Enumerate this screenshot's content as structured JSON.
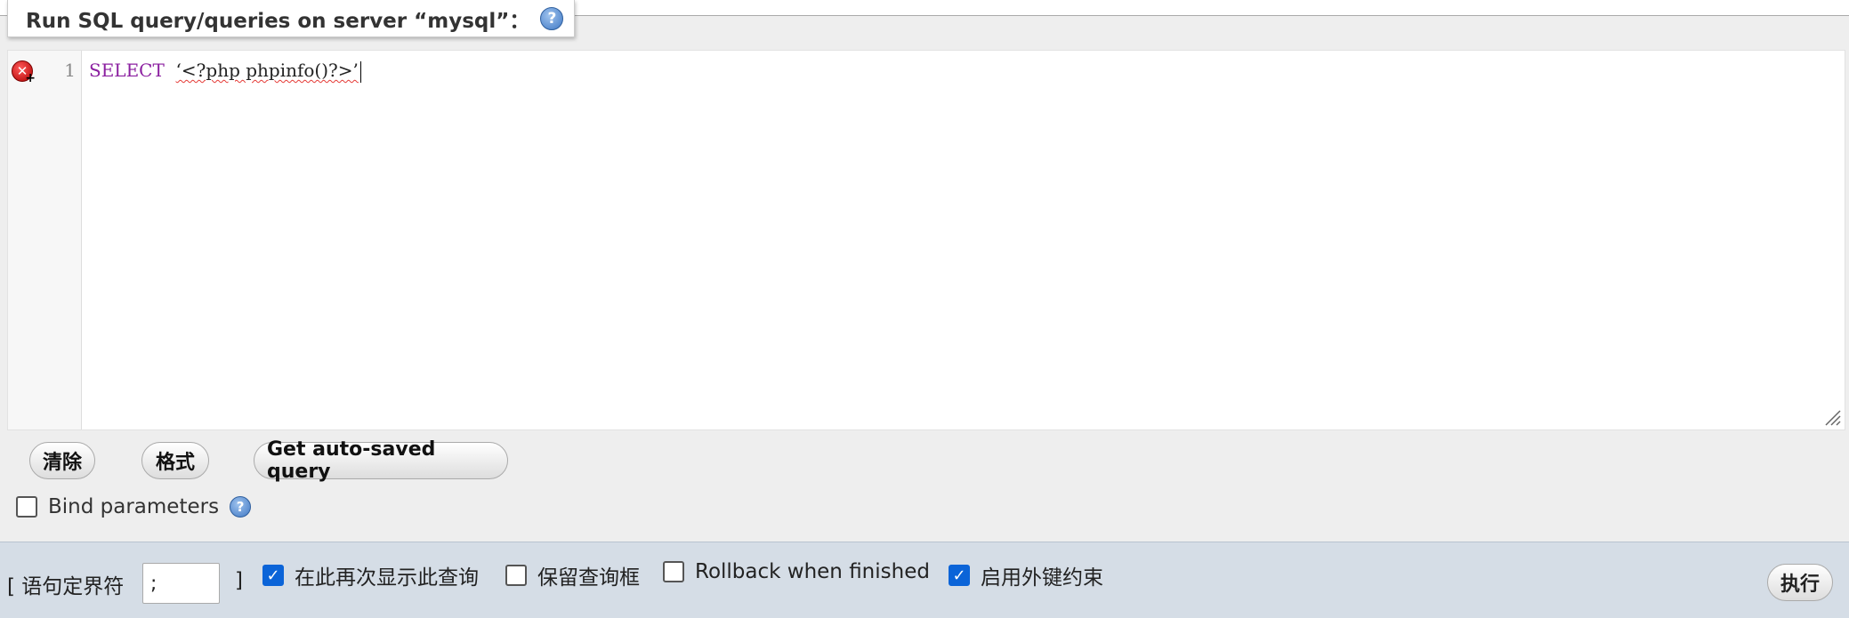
{
  "fieldset": {
    "legend": "Run SQL query/queries on server “mysql”：",
    "help_icon": "help-icon"
  },
  "editor": {
    "line_number": "1",
    "keyword": "SELECT",
    "literal": "‘<?php phpinfo()?>’",
    "error_marker": "error-icon"
  },
  "buttons": {
    "clear": "清除",
    "format": "格式",
    "autosaved": "Get auto-saved query"
  },
  "bind_parameters": {
    "label": "Bind parameters",
    "checked": false
  },
  "bottom_bar": {
    "delimiter_open": "[ 语句定界符",
    "delimiter_value": ";",
    "delimiter_close": "]",
    "show_query_again": {
      "label": "在此再次显示此查询",
      "checked": true
    },
    "retain_query_box": {
      "label": "保留查询框",
      "checked": false
    },
    "rollback": {
      "label": "Rollback when finished",
      "checked": false
    },
    "foreign_keys": {
      "label": "启用外键约束",
      "checked": true
    },
    "go": "执行"
  },
  "colors": {
    "keyword": "#8b1fa0",
    "checkbox_checked": "#0b64d8",
    "bottom_bar": "#d5dde6",
    "panel": "#eeeeee"
  }
}
